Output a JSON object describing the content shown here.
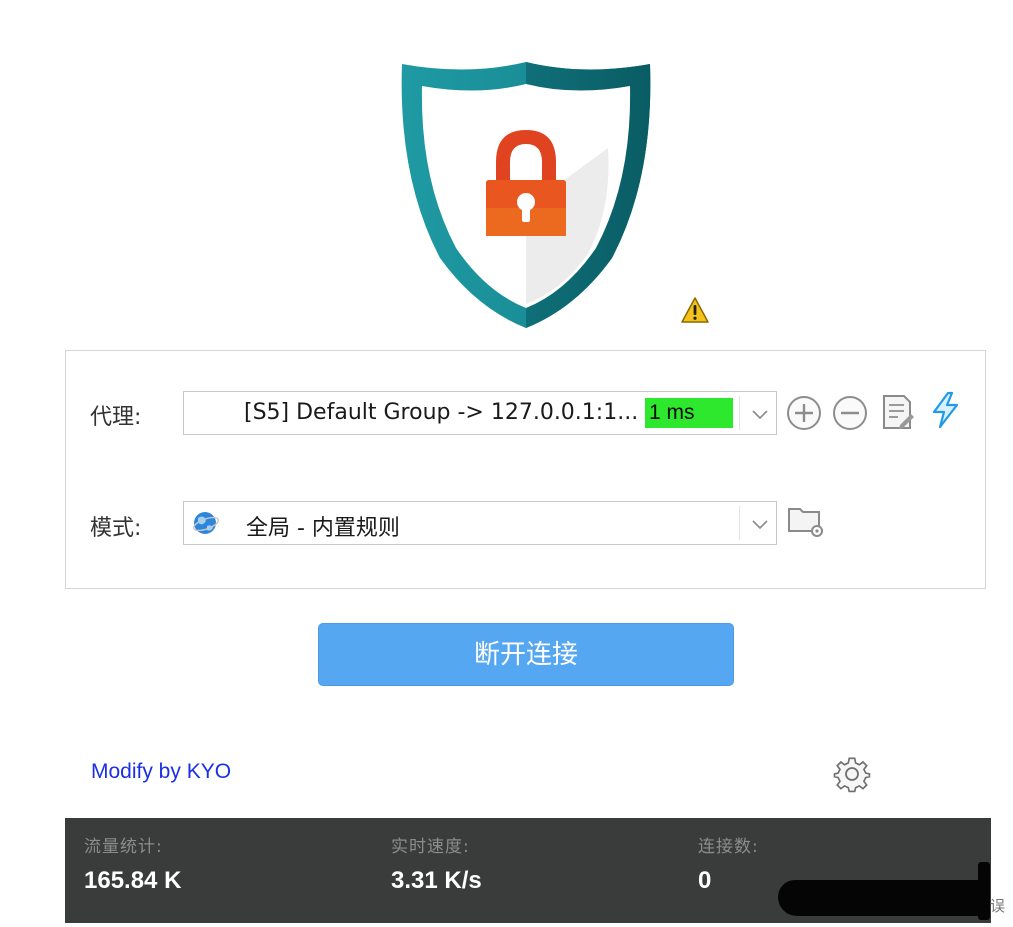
{
  "logo": {
    "icon": "shield-lock-icon",
    "warning_icon": "warning-icon",
    "colors": {
      "shield": "#1a8f97",
      "lock": "#e0431f"
    }
  },
  "panel": {
    "proxy": {
      "label": "代理:",
      "value": "[S5] Default Group -> 127.0.0.1:1...",
      "latency": "1 ms",
      "latency_color": "#2ee82e",
      "actions": [
        "add-icon",
        "remove-icon",
        "edit-icon",
        "speedtest-icon"
      ]
    },
    "mode": {
      "label": "模式:",
      "value": "全局 - 内置规则",
      "icon": "globe-icon",
      "action": "rules-folder-icon"
    }
  },
  "connect_button": {
    "label": "断开连接",
    "color": "#55a7f2"
  },
  "footer": {
    "link": "Modify by KYO",
    "settings_icon": "gear-icon"
  },
  "status": {
    "traffic_label": "流量统计:",
    "traffic_value": "165.84 K",
    "speed_label": "实时速度:",
    "speed_value": "3.31 K/s",
    "connections_label": "连接数:",
    "connections_value": "0",
    "edge_glyph": "误"
  }
}
